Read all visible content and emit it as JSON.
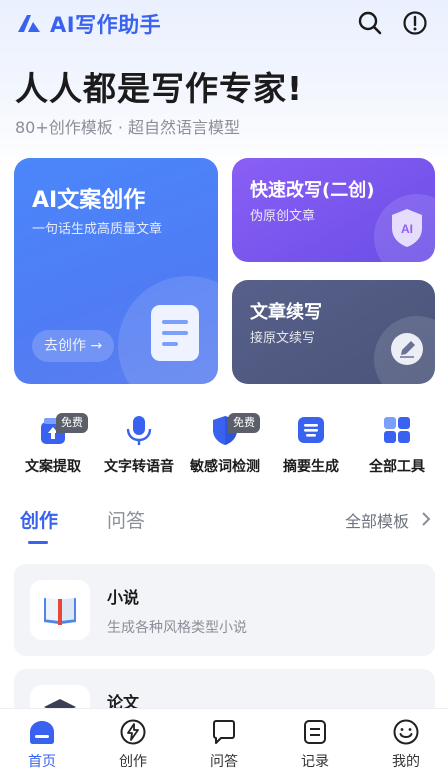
{
  "header": {
    "app_title": "AI写作助手",
    "icons": [
      "logo-icon",
      "search-icon",
      "info-icon"
    ]
  },
  "hero": {
    "title": "人人都是写作专家!",
    "subtitle": "80+创作模板 · 超自然语言模型"
  },
  "feature_cards": {
    "main": {
      "title": "AI文案创作",
      "subtitle": "一句话生成高质量文章",
      "button": "去创作"
    },
    "rewrite": {
      "title": "快速改写(二创)",
      "subtitle": "伪原创文章",
      "badge_text": "AI"
    },
    "continue": {
      "title": "文章续写",
      "subtitle": "接原文续写"
    }
  },
  "tools": [
    {
      "label": "文案提取",
      "badge": "免费",
      "icon": "upload-card-icon"
    },
    {
      "label": "文字转语音",
      "badge": "",
      "icon": "microphone-icon"
    },
    {
      "label": "敏感词检测",
      "badge": "免费",
      "icon": "shield-icon"
    },
    {
      "label": "摘要生成",
      "badge": "",
      "icon": "summary-icon"
    },
    {
      "label": "全部工具",
      "badge": "",
      "icon": "grid-icon"
    }
  ],
  "tabs": {
    "items": [
      "创作",
      "问答"
    ],
    "active": "创作",
    "all_templates": "全部模板"
  },
  "templates": [
    {
      "name": "小说",
      "desc": "生成各种风格类型小说",
      "icon": "book-icon"
    },
    {
      "name": "论文",
      "desc": "",
      "icon": "graduation-cap-icon"
    }
  ],
  "bottom_nav": [
    {
      "label": "首页",
      "icon": "home-icon",
      "active": true
    },
    {
      "label": "创作",
      "icon": "lightning-icon",
      "active": false
    },
    {
      "label": "问答",
      "icon": "chat-icon",
      "active": false
    },
    {
      "label": "记录",
      "icon": "record-icon",
      "active": false
    },
    {
      "label": "我的",
      "icon": "smile-icon",
      "active": false
    }
  ],
  "colors": {
    "accent": "#3a62f0",
    "card_main": "#4f7cf4",
    "card_rewrite": "#7a55ee",
    "card_continue": "#515b82",
    "badge_bg": "#5b5f6a"
  }
}
